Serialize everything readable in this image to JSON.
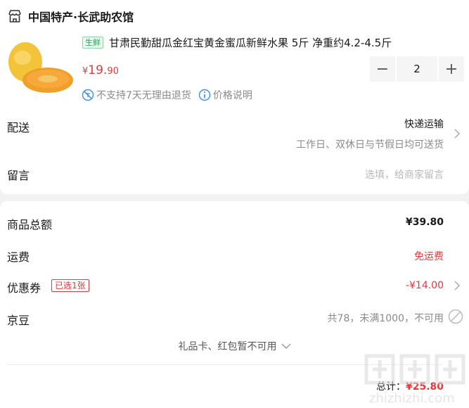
{
  "shop": {
    "name": "中国特产·长武助农馆",
    "icon": "store-icon"
  },
  "product": {
    "tag": "生鲜",
    "title": "甘肃民勤甜瓜金红宝黄金蜜瓜新鲜水果 5斤 净重约4.2-4.5斤",
    "price_symbol": "¥",
    "price_int": "19.",
    "price_dec": "90",
    "quantity": "2",
    "minus": "−",
    "plus": "+",
    "note_return": "不支持7天无理由退货",
    "note_price": "价格说明"
  },
  "delivery": {
    "label": "配送",
    "method": "快递运输",
    "schedule": "工作日、双休日与节假日均可送货"
  },
  "message": {
    "label": "留言",
    "placeholder": "选填，给商家留言"
  },
  "summary": {
    "goods_label": "商品总额",
    "goods_value": "¥39.80",
    "freight_label": "运费",
    "freight_value": "免运费",
    "coupon_label": "优惠券",
    "coupon_badge": "已选1张",
    "coupon_value": "-¥14.00",
    "jd_label": "京豆",
    "jd_value": "共78，未满1000，不可用",
    "gift_text": "礼品卡、红包暂不可用",
    "total_label": "总计：",
    "total_value": "¥25.80"
  },
  "colors": {
    "accent": "#e4393c",
    "fresh": "#2fa360",
    "info": "#3a8ee6"
  }
}
